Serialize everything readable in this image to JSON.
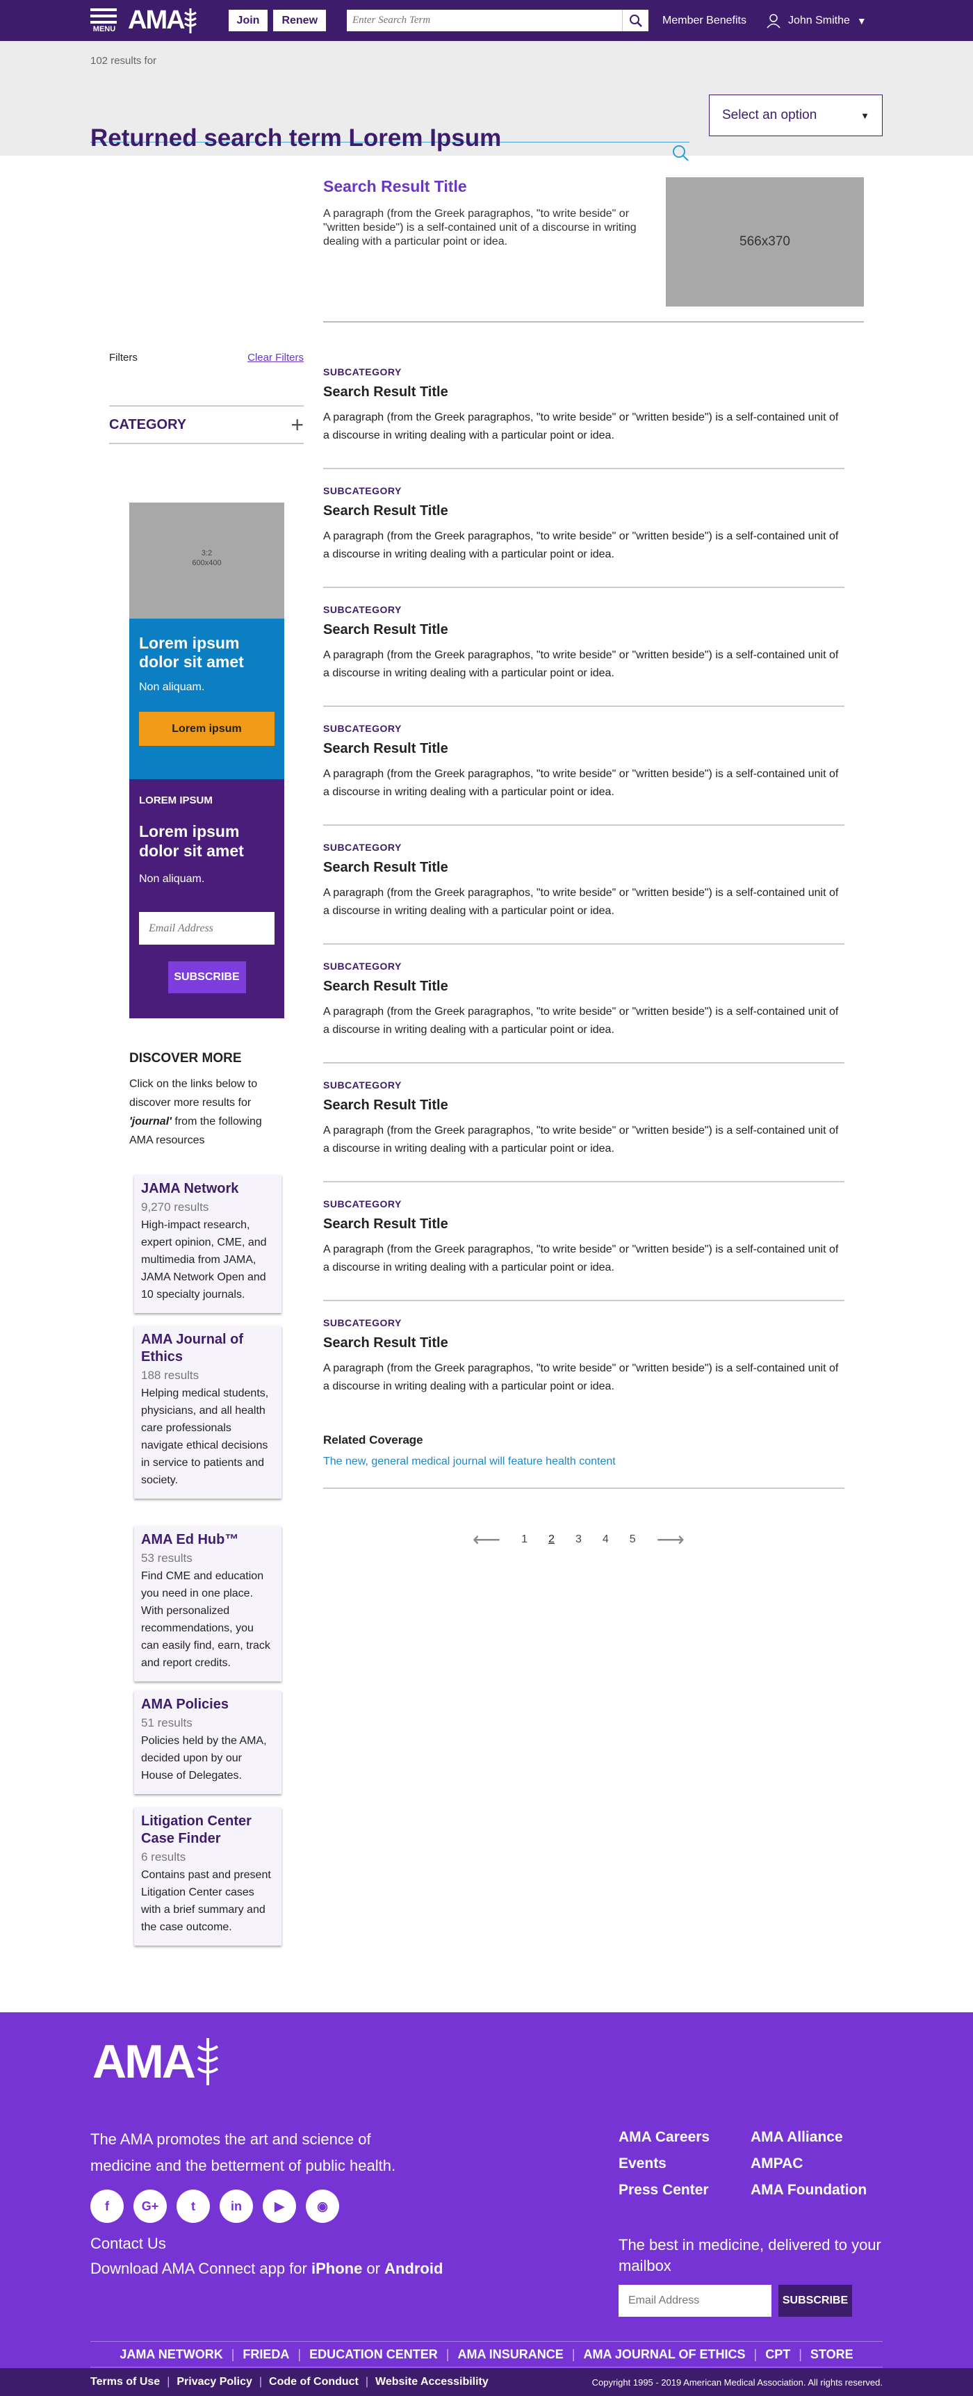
{
  "header": {
    "menu_label": "MENU",
    "logo": "AMA",
    "join": "Join",
    "renew": "Renew",
    "search_placeholder": "Enter Search Term",
    "member_benefits": "Member Benefits",
    "user_name": "John Smithe"
  },
  "search": {
    "count": "102 results for",
    "term": "Returned search term Lorem Ipsum",
    "select_placeholder": "Select an option"
  },
  "featured": {
    "title": "Search Result Title",
    "text": "A paragraph (from the Greek paragraphos, \"to write beside\" or \"written beside\") is a self-contained unit of a discourse in writing dealing with a particular point or idea.",
    "image_label": "566x370"
  },
  "filters": {
    "label": "Filters",
    "clear": "Clear Filters",
    "category": "CATEGORY"
  },
  "promo1": {
    "image_line1": "3:2",
    "image_line2": "600x400",
    "heading": "Lorem ipsum dolor sit amet",
    "sub": "Non aliquam.",
    "button": "Lorem ipsum"
  },
  "promo2": {
    "kicker": "LOREM IPSUM",
    "heading": "Lorem ipsum dolor sit amet",
    "sub": "Non aliquam.",
    "email_placeholder": "Email Address",
    "button": "SUBSCRIBE"
  },
  "discover": {
    "heading": "DISCOVER MORE",
    "text_before": "Click on the links below to discover more results for ",
    "term": "'journal'",
    "text_after": " from the following AMA resources",
    "cards": [
      {
        "title": "JAMA Network",
        "count": "9,270 results",
        "desc": "High-impact research, expert opinion, CME, and multimedia from JAMA, JAMA Network Open and 10 specialty journals."
      },
      {
        "title": "AMA Journal of Ethics",
        "count": "188 results",
        "desc": "Helping medical students, physicians, and all health care professionals navigate ethical decisions in service to patients and society."
      },
      {
        "title": "AMA Ed Hub™",
        "count": "53 results",
        "desc": "Find CME and education you need in one place. With personalized recommendations, you can easily find, earn, track and report credits."
      },
      {
        "title": "AMA Policies",
        "count": "51 results",
        "desc": "Policies held by the AMA, decided upon by our House of Delegates."
      },
      {
        "title": "Litigation Center Case Finder",
        "count": "6 results",
        "desc": "Contains past and present Litigation Center cases with a brief summary and the case outcome."
      }
    ]
  },
  "results": [
    {
      "subcategory": "SUBCATEGORY",
      "title": "Search Result Title",
      "text": "A paragraph (from the Greek paragraphos, \"to write beside\" or \"written beside\") is a self-contained unit of a discourse in writing dealing with a particular point or idea."
    },
    {
      "subcategory": "SUBCATEGORY",
      "title": "Search Result Title",
      "text": "A paragraph (from the Greek paragraphos, \"to write beside\" or \"written beside\") is a self-contained unit of a discourse in writing dealing with a particular point or idea."
    },
    {
      "subcategory": "SUBCATEGORY",
      "title": "Search Result Title",
      "text": "A paragraph (from the Greek paragraphos, \"to write beside\" or \"written beside\") is a self-contained unit of a discourse in writing dealing with a particular point or idea."
    },
    {
      "subcategory": "SUBCATEGORY",
      "title": "Search Result Title",
      "text": "A paragraph (from the Greek paragraphos, \"to write beside\" or \"written beside\") is a self-contained unit of a discourse in writing dealing with a particular point or idea."
    },
    {
      "subcategory": "SUBCATEGORY",
      "title": "Search Result Title",
      "text": "A paragraph (from the Greek paragraphos, \"to write beside\" or \"written beside\") is a self-contained unit of a discourse in writing dealing with a particular point or idea."
    },
    {
      "subcategory": "SUBCATEGORY",
      "title": "Search Result Title",
      "text": "A paragraph (from the Greek paragraphos, \"to write beside\" or \"written beside\") is a self-contained unit of a discourse in writing dealing with a particular point or idea."
    },
    {
      "subcategory": "SUBCATEGORY",
      "title": "Search Result Title",
      "text": "A paragraph (from the Greek paragraphos, \"to write beside\" or \"written beside\") is a self-contained unit of a discourse in writing dealing with a particular point or idea."
    },
    {
      "subcategory": "SUBCATEGORY",
      "title": "Search Result Title",
      "text": "A paragraph (from the Greek paragraphos, \"to write beside\" or \"written beside\") is a self-contained unit of a discourse in writing dealing with a particular point or idea."
    },
    {
      "subcategory": "SUBCATEGORY",
      "title": "Search Result Title",
      "text": "A paragraph (from the Greek paragraphos, \"to write beside\" or \"written beside\") is a self-contained unit of a discourse in writing dealing with a particular point or idea."
    }
  ],
  "related": {
    "heading": "Related Coverage",
    "link": "The new, general medical journal will feature health content"
  },
  "pagination": {
    "pages": [
      "1",
      "2",
      "3",
      "4",
      "5"
    ],
    "current": "2"
  },
  "footer": {
    "logo": "AMA",
    "mission": "The AMA promotes the art and science of medicine and the betterment of public health.",
    "social_icons": [
      "facebook-icon",
      "google-plus-icon",
      "twitter-icon",
      "linkedin-icon",
      "youtube-icon",
      "instagram-icon"
    ],
    "contact": "Contact Us",
    "app_text": "Download AMA Connect app for ",
    "app_iphone": "iPhone",
    "app_or": " or ",
    "app_android": "Android",
    "links": [
      "AMA Careers",
      "AMA Alliance",
      "Events",
      "AMPAC",
      "Press Center",
      "AMA Foundation"
    ],
    "newsletter": "The best in medicine, delivered to your mailbox",
    "email_placeholder": "Email Address",
    "subscribe": "SUBSCRIBE",
    "nav": [
      "JAMA NETWORK",
      "FRIEDA",
      "EDUCATION CENTER",
      "AMA INSURANCE",
      "AMA JOURNAL OF ETHICS",
      "CPT",
      "STORE"
    ],
    "legal": [
      "Terms of Use",
      "Privacy Policy",
      "Code of Conduct",
      "Website Accessibility"
    ],
    "copyright": "Copyright 1995 - 2019 American Medical Association. All rights reserved."
  },
  "colors": {
    "brand_purple": "#3d1d6b",
    "accent_purple": "#7634d4",
    "link_blue": "#1a88c9",
    "promo_orange": "#f19a17"
  }
}
